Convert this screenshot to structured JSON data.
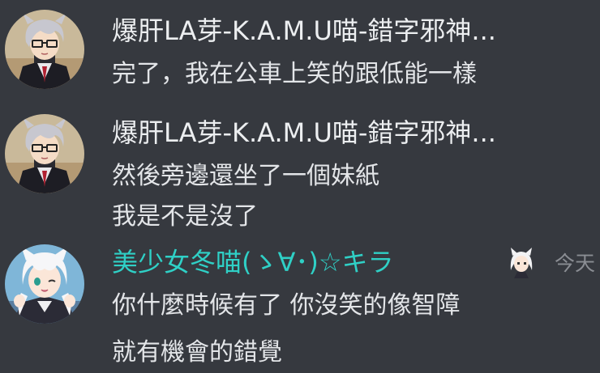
{
  "messages": [
    {
      "author": "爆肝LA芽-K.A.M.U喵-錯字邪神...",
      "author_color": "#eceef0",
      "avatar_icon": "anime-boy-avatar",
      "lines": [
        "完了，我在公車上笑的跟低能一樣"
      ]
    },
    {
      "author": "爆肝LA芽-K.A.M.U喵-錯字邪神...",
      "author_color": "#eceef0",
      "avatar_icon": "anime-boy-avatar",
      "lines": [
        "然後旁邊還坐了一個妹紙",
        "我是不是沒了"
      ]
    },
    {
      "author": "美少女冬喵(ゝ∀･)☆キラ",
      "author_color": "#2fd0c6",
      "avatar_icon": "anime-fox-girl-avatar",
      "badge_icon": "fox-girl-badge-icon",
      "timestamp": "今天",
      "lines": [
        "你什麼時候有了  你沒笑的像智障",
        "就有機會的錯覺"
      ]
    }
  ],
  "colors": {
    "background": "#36393f",
    "text": "#e3e5e8",
    "muted": "#8a8d93"
  }
}
